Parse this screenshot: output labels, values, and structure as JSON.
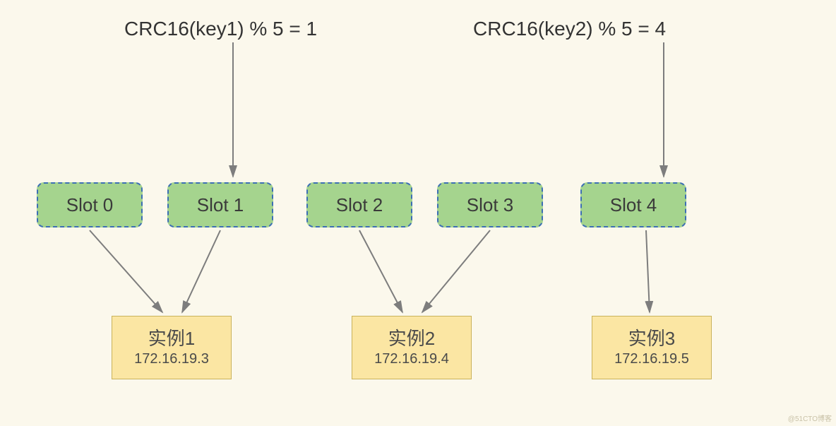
{
  "formulas": {
    "left": "CRC16(key1) %  5 = 1",
    "right": "CRC16(key2) %  5 = 4"
  },
  "slots": [
    {
      "label": "Slot 0"
    },
    {
      "label": "Slot 1"
    },
    {
      "label": "Slot 2"
    },
    {
      "label": "Slot 3"
    },
    {
      "label": "Slot 4"
    }
  ],
  "instances": [
    {
      "title": "实例1",
      "ip": "172.16.19.3"
    },
    {
      "title": "实例2",
      "ip": "172.16.19.4"
    },
    {
      "title": "实例3",
      "ip": "172.16.19.5"
    }
  ],
  "watermark": "@51CTO博客"
}
